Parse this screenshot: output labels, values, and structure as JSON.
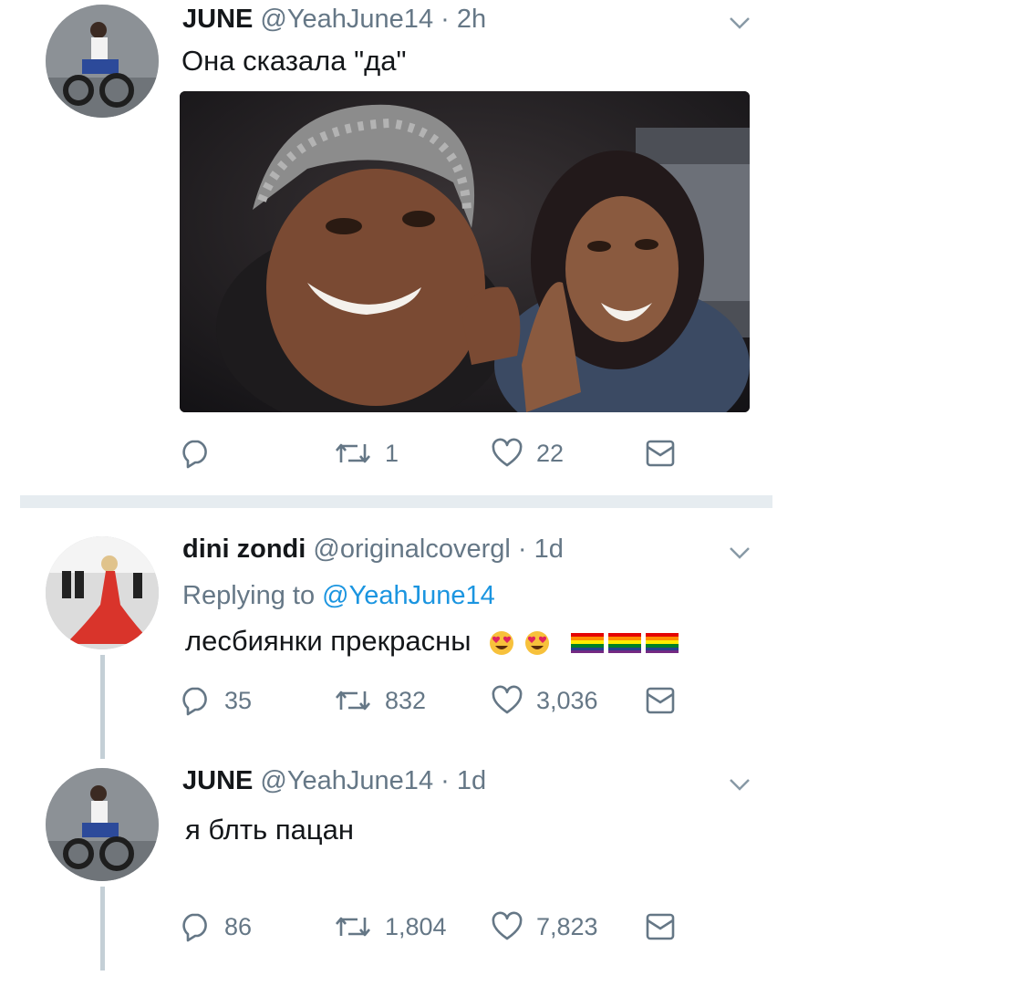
{
  "tweet": {
    "name": "JUNE",
    "handle": "@YeahJune14",
    "time": "2h",
    "text": "Она сказала \"да\"",
    "replies": "",
    "retweets": "1",
    "likes": "22"
  },
  "reply1": {
    "name": "dini zondi",
    "handle": "@originalcovergl",
    "time": "1d",
    "replying_to_prefix": "Replying to",
    "replying_to_handle": "@YeahJune14",
    "text": "лесбиянки прекрасны",
    "replies": "35",
    "retweets": "832",
    "likes": "3,036"
  },
  "reply2": {
    "name": "JUNE",
    "handle": "@YeahJune14",
    "time": "1d",
    "text": "я блть пацан",
    "replies": "86",
    "retweets": "1,804",
    "likes": "7,823"
  },
  "separator": "·",
  "colors": {
    "text": "#14171a",
    "meta": "#657786",
    "mention": "#1b95e0",
    "divider": "#e6ecf0"
  },
  "icons": [
    "chevron-down-icon",
    "reply-icon",
    "retweet-icon",
    "like-icon",
    "dm-icon",
    "heart-eyes-emoji",
    "rainbow-flag-emoji"
  ]
}
